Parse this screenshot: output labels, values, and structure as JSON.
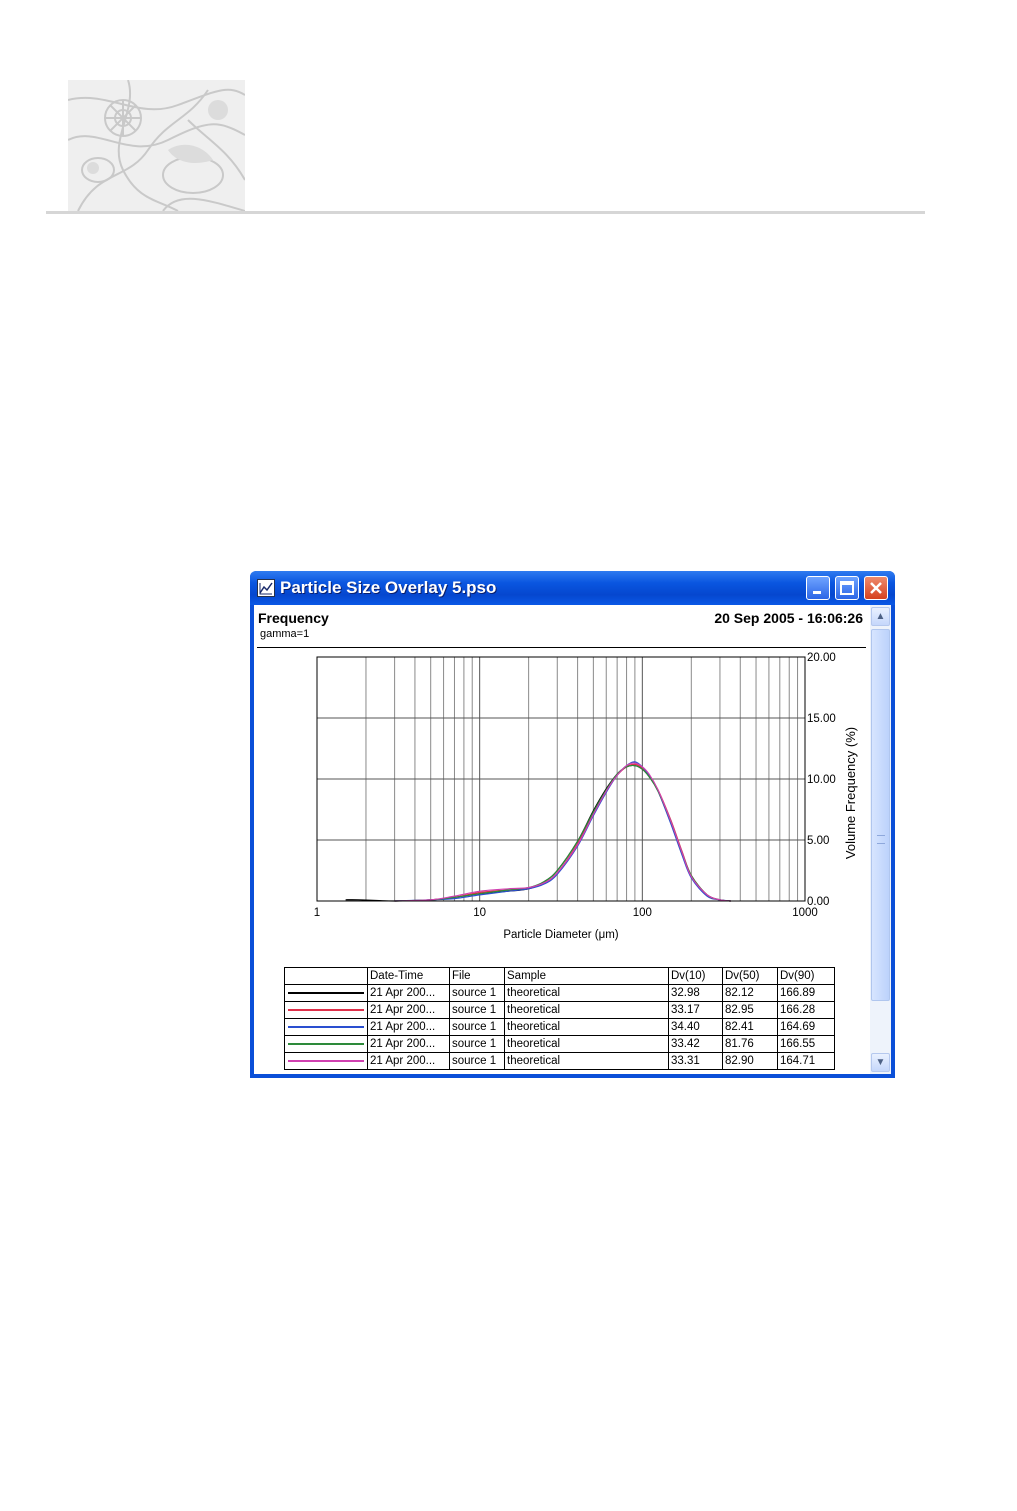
{
  "window": {
    "title": "Particle Size Overlay 5.pso"
  },
  "report": {
    "title": "Frequency",
    "subtitle": "gamma=1",
    "timestamp": "20 Sep 2005 - 16:06:26"
  },
  "chart_data": {
    "type": "line",
    "xlabel": "Particle Diameter (μm)",
    "ylabel": "Volume Frequency (%)",
    "x_scale": "log",
    "xlim": [
      1,
      1000
    ],
    "ylim": [
      0,
      20
    ],
    "x_ticks": [
      "1",
      "10",
      "100",
      "1000"
    ],
    "y_ticks": [
      "0.00",
      "5.00",
      "10.00",
      "15.00",
      "20.00"
    ],
    "grid": true,
    "series": [
      {
        "color": "#000000",
        "x": [
          1.5,
          1.8,
          3,
          5,
          7,
          10,
          15,
          20,
          25,
          30,
          40,
          50,
          60,
          70,
          80,
          90,
          100,
          110,
          125,
          150,
          175,
          200,
          250,
          300,
          350
        ],
        "y": [
          0.1,
          0.1,
          0,
          0.1,
          0.3,
          0.6,
          0.8,
          1.0,
          1.6,
          2.5,
          4.9,
          7.4,
          9.2,
          10.4,
          11.0,
          11.1,
          10.8,
          10.2,
          9.0,
          6.4,
          3.9,
          2.0,
          0.5,
          0.1,
          0
        ]
      },
      {
        "color": "#e0304a",
        "x": [
          3,
          5,
          7,
          10,
          15,
          20,
          25,
          30,
          40,
          50,
          60,
          70,
          80,
          90,
          100,
          110,
          125,
          150,
          175,
          200,
          250,
          300,
          350
        ],
        "y": [
          0,
          0.1,
          0.3,
          0.7,
          0.9,
          1.0,
          1.5,
          2.3,
          4.7,
          7.2,
          9.0,
          10.3,
          11.0,
          11.2,
          10.9,
          10.3,
          9.1,
          6.6,
          4.1,
          2.1,
          0.5,
          0.1,
          0
        ]
      },
      {
        "color": "#2a4fd0",
        "x": [
          3,
          5,
          7,
          10,
          15,
          20,
          25,
          30,
          40,
          50,
          60,
          70,
          80,
          90,
          100,
          110,
          125,
          150,
          175,
          200,
          250,
          300,
          350
        ],
        "y": [
          0,
          0.1,
          0.2,
          0.5,
          0.8,
          1.0,
          1.4,
          2.2,
          4.5,
          7.0,
          8.9,
          10.3,
          11.1,
          11.4,
          11.0,
          10.3,
          9.0,
          6.3,
          3.8,
          1.9,
          0.4,
          0.1,
          0
        ]
      },
      {
        "color": "#2d8a3a",
        "x": [
          3,
          5,
          7,
          10,
          15,
          20,
          25,
          30,
          40,
          50,
          60,
          70,
          80,
          90,
          100,
          110,
          125,
          150,
          175,
          200,
          250,
          300,
          350
        ],
        "y": [
          0,
          0.1,
          0.3,
          0.6,
          0.9,
          1.1,
          1.6,
          2.5,
          4.9,
          7.3,
          9.1,
          10.4,
          11.0,
          11.1,
          10.8,
          10.2,
          9.0,
          6.5,
          4.0,
          2.1,
          0.5,
          0.1,
          0
        ]
      },
      {
        "color": "#d040b0",
        "x": [
          3,
          5,
          7,
          10,
          15,
          20,
          25,
          30,
          40,
          50,
          60,
          70,
          80,
          90,
          100,
          110,
          125,
          150,
          175,
          200,
          250,
          300,
          350
        ],
        "y": [
          0,
          0.1,
          0.4,
          0.8,
          1.0,
          1.1,
          1.5,
          2.3,
          4.6,
          7.1,
          9.0,
          10.3,
          11.1,
          11.3,
          11.0,
          10.4,
          9.1,
          6.5,
          4.0,
          2.0,
          0.5,
          0.1,
          0
        ]
      }
    ]
  },
  "results_table": {
    "headers": [
      "",
      "Date-Time",
      "File",
      "Sample",
      "Dv(10)",
      "Dv(50)",
      "Dv(90)"
    ],
    "rows": [
      {
        "color": "#000000",
        "date_time": "21 Apr 200...",
        "file": "source 1",
        "sample": "theoretical",
        "dv10": "32.98",
        "dv50": "82.12",
        "dv90": "166.89"
      },
      {
        "color": "#e0304a",
        "date_time": "21 Apr 200...",
        "file": "source 1",
        "sample": "theoretical",
        "dv10": "33.17",
        "dv50": "82.95",
        "dv90": "166.28"
      },
      {
        "color": "#2a4fd0",
        "date_time": "21 Apr 200...",
        "file": "source 1",
        "sample": "theoretical",
        "dv10": "34.40",
        "dv50": "82.41",
        "dv90": "164.69"
      },
      {
        "color": "#2d8a3a",
        "date_time": "21 Apr 200...",
        "file": "source 1",
        "sample": "theoretical",
        "dv10": "33.42",
        "dv50": "81.76",
        "dv90": "166.55"
      },
      {
        "color": "#d040b0",
        "date_time": "21 Apr 200...",
        "file": "source 1",
        "sample": "theoretical",
        "dv10": "33.31",
        "dv50": "82.90",
        "dv90": "164.71"
      }
    ]
  },
  "icons": {
    "app": "chart-window-icon",
    "minimize": "minimize-icon",
    "maximize": "maximize-icon",
    "close": "close-icon",
    "scroll_up": "scroll-up-arrow-icon",
    "scroll_down": "scroll-down-arrow-icon"
  }
}
